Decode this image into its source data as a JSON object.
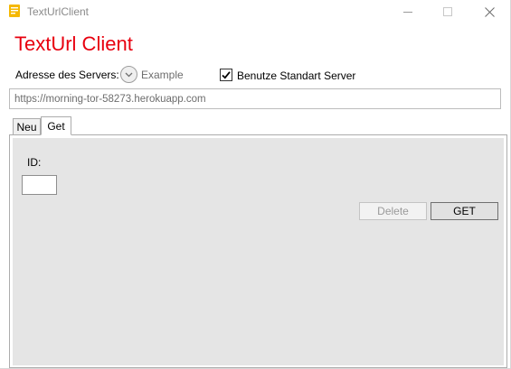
{
  "window": {
    "title": "TextUrlClient",
    "icon": "note-icon",
    "controls": {
      "minimize": "minimize-icon",
      "maximize": "maximize-icon",
      "close": "close-icon"
    }
  },
  "header": {
    "title": "TextUrl Client",
    "title_color": "#e8000f"
  },
  "server": {
    "label": "Adresse des Servers:",
    "example_label": "Example",
    "use_standard_label": "Benutze Standart Server",
    "use_standard_checked": true,
    "url_value": "https://morning-tor-58273.herokuapp.com"
  },
  "tabs": [
    {
      "label": "Neu",
      "active": false
    },
    {
      "label": "Get",
      "active": true
    }
  ],
  "get_panel": {
    "id_label": "ID:",
    "id_value": "",
    "delete_label": "Delete",
    "delete_enabled": false,
    "get_label": "GET"
  }
}
